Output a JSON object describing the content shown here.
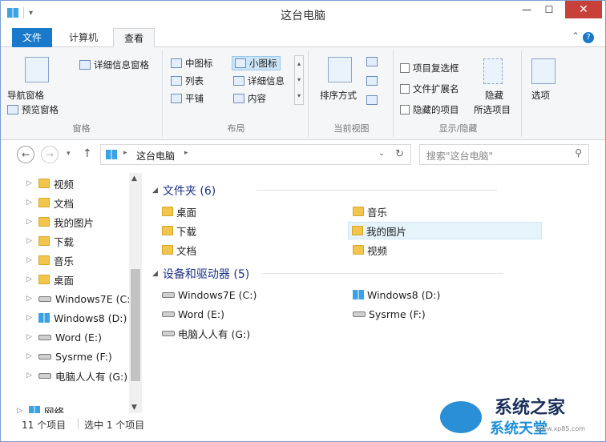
{
  "window": {
    "title": "这台电脑"
  },
  "tabs": [
    {
      "label": "文件"
    },
    {
      "label": "计算机"
    },
    {
      "label": "查看"
    }
  ],
  "ribbon": {
    "nav_pane": "导航窗格",
    "preview_pane": "预览窗格",
    "details_pane": "详细信息窗格",
    "pane_group": "窗格",
    "layout": {
      "medium_icons": "中图标",
      "small_icons": "小图标",
      "list": "列表",
      "details": "详细信息",
      "tiles": "平铺",
      "content": "内容"
    },
    "layout_group": "布局",
    "sort_by": "排序方式",
    "current_view_group": "当前视图",
    "item_checkboxes": "项目复选框",
    "file_extensions": "文件扩展名",
    "hidden_items": "隐藏的项目",
    "hide": "隐藏",
    "selected_items": "所选项目",
    "show_hide_group": "显示/隐藏",
    "options": "选项"
  },
  "address": {
    "crumb": "这台电脑",
    "search_placeholder": "搜索\"这台电脑\""
  },
  "sidebar": {
    "items": [
      {
        "label": "视频"
      },
      {
        "label": "文档"
      },
      {
        "label": "我的图片"
      },
      {
        "label": "下载"
      },
      {
        "label": "音乐"
      },
      {
        "label": "桌面"
      },
      {
        "label": "Windows7E (C:)"
      },
      {
        "label": "Windows8 (D:)"
      },
      {
        "label": "Word (E:)"
      },
      {
        "label": "Sysrme (F:)"
      },
      {
        "label": "电脑人人有 (G:)"
      },
      {
        "label": "网络"
      }
    ]
  },
  "main": {
    "folders_header": "文件夹 (6)",
    "folders": [
      {
        "label": "桌面"
      },
      {
        "label": "音乐"
      },
      {
        "label": "下载"
      },
      {
        "label": "我的图片"
      },
      {
        "label": "文档"
      },
      {
        "label": "视频"
      }
    ],
    "drives_header": "设备和驱动器 (5)",
    "drives": [
      {
        "label": "Windows7E (C:)"
      },
      {
        "label": "Windows8 (D:)"
      },
      {
        "label": "Word (E:)"
      },
      {
        "label": "Sysrme (F:)"
      },
      {
        "label": "电脑人人有 (G:)"
      }
    ]
  },
  "status": {
    "count": "11 个项目",
    "selected": "选中 1 个项目"
  },
  "watermark": {
    "title": "系统之家",
    "sub": "系统天堂",
    "url": "www.xp85.com"
  },
  "colors": {
    "accent": "#1979ca",
    "close": "#c7403a",
    "header": "#1e3287"
  }
}
